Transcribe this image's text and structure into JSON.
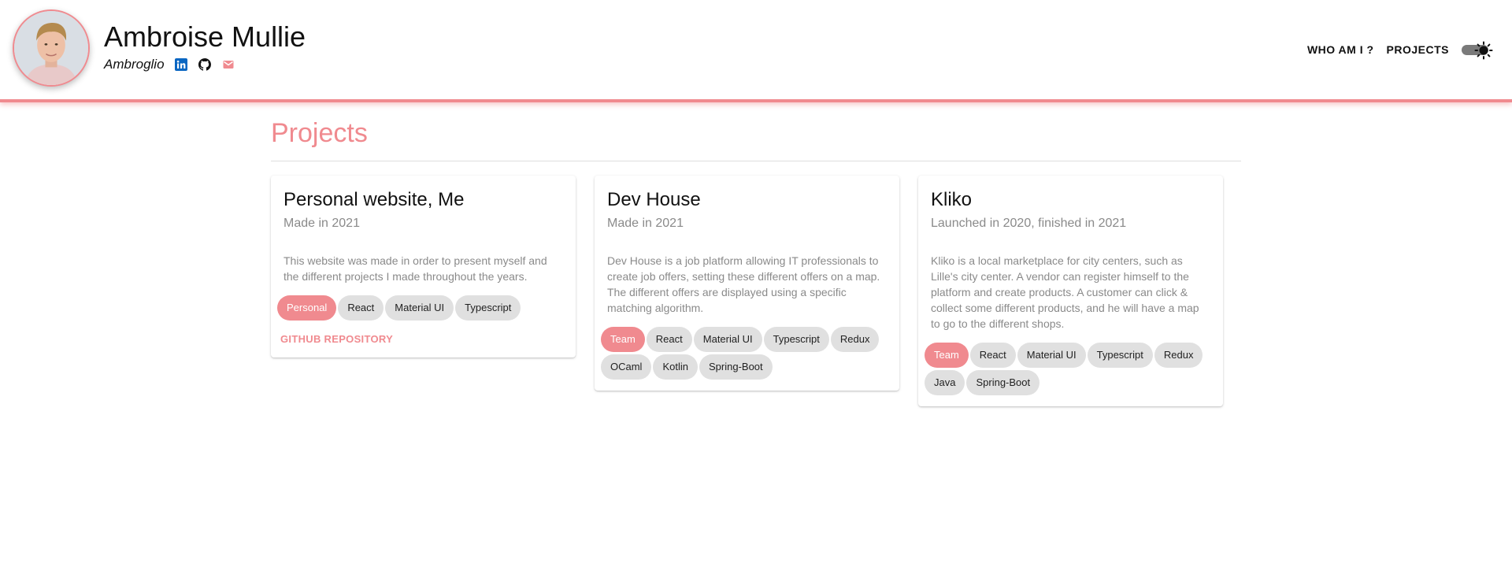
{
  "profile": {
    "name": "Ambroise Mullie",
    "nickname": "Ambroglio",
    "icons": {
      "linkedin": "linkedin-icon",
      "github": "github-icon",
      "email": "email-icon"
    }
  },
  "nav": {
    "items": [
      "WHO AM I ?",
      "PROJECTS"
    ],
    "theme_toggle_icon": "sun-icon"
  },
  "colors": {
    "accent": "#f08a8f",
    "chip": "#e0e0e0",
    "muted_text": "#8a8a8a",
    "linkedin": "#0a66c2"
  },
  "page": {
    "title": "Projects"
  },
  "projects": [
    {
      "title": "Personal website, Me",
      "subtitle": "Made in 2021",
      "description": "This website was made in order to present myself and the different projects I made throughout the years.",
      "tags": [
        "Personal",
        "React",
        "Material UI",
        "Typescript"
      ],
      "action": "GITHUB REPOSITORY"
    },
    {
      "title": "Dev House",
      "subtitle": "Made in 2021",
      "description": "Dev House is a job platform allowing IT professionals to create job offers, setting these different offers on a map. The different offers are displayed using a specific matching algorithm.",
      "tags": [
        "Team",
        "React",
        "Material UI",
        "Typescript",
        "Redux",
        "OCaml",
        "Kotlin",
        "Spring-Boot"
      ]
    },
    {
      "title": "Kliko",
      "subtitle": "Launched in 2020, finished in 2021",
      "description": "Kliko is a local marketplace for city centers, such as Lille's city center. A vendor can register himself to the platform and create products. A customer can click & collect some different products, and he will have a map to go to the different shops.",
      "tags": [
        "Team",
        "React",
        "Material UI",
        "Typescript",
        "Redux",
        "Java",
        "Spring-Boot"
      ]
    }
  ]
}
